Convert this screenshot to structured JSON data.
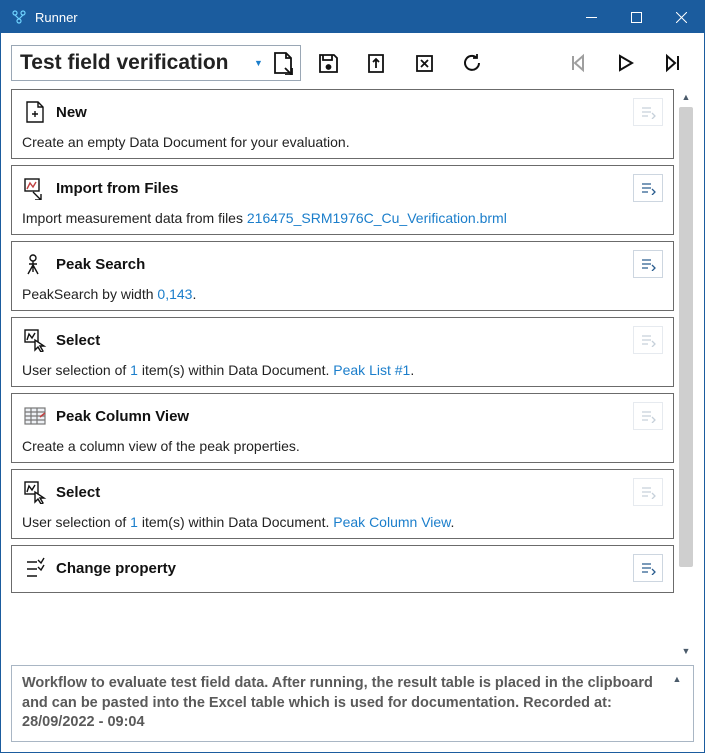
{
  "window": {
    "title": "Runner"
  },
  "toolbar": {
    "dropdown_text": "Test field verification"
  },
  "steps": [
    {
      "title": "New",
      "desc_plain": "Create an empty Data Document for your evaluation.",
      "edit_enabled": false
    },
    {
      "title": "Import from Files",
      "desc_prefix": "Import measurement data from files ",
      "link": "216475_SRM1976C_Cu_Verification.brml",
      "desc_suffix": "",
      "edit_enabled": true
    },
    {
      "title": "Peak Search",
      "desc_prefix": "PeakSearch by width ",
      "link": "0,143",
      "desc_suffix": ".",
      "edit_enabled": true
    },
    {
      "title": "Select",
      "desc_prefix": "User selection of ",
      "link": "1",
      "desc_mid": " item(s) within Data Document. ",
      "link2": "Peak List #1",
      "desc_suffix": ".",
      "edit_enabled": false
    },
    {
      "title": "Peak Column View",
      "desc_plain": "Create a column view of the peak properties.",
      "edit_enabled": false
    },
    {
      "title": "Select",
      "desc_prefix": "User selection of ",
      "link": "1",
      "desc_mid": " item(s) within Data Document. ",
      "link2": "Peak Column View",
      "desc_suffix": ".",
      "edit_enabled": false
    },
    {
      "title": "Change property",
      "edit_enabled": true
    }
  ],
  "footer": {
    "text": "Workflow to evaluate test field data. After running, the result table is placed in the clipboard and can be pasted into the Excel table which is used for documentation. Recorded at: 28/09/2022 - 09:04"
  }
}
